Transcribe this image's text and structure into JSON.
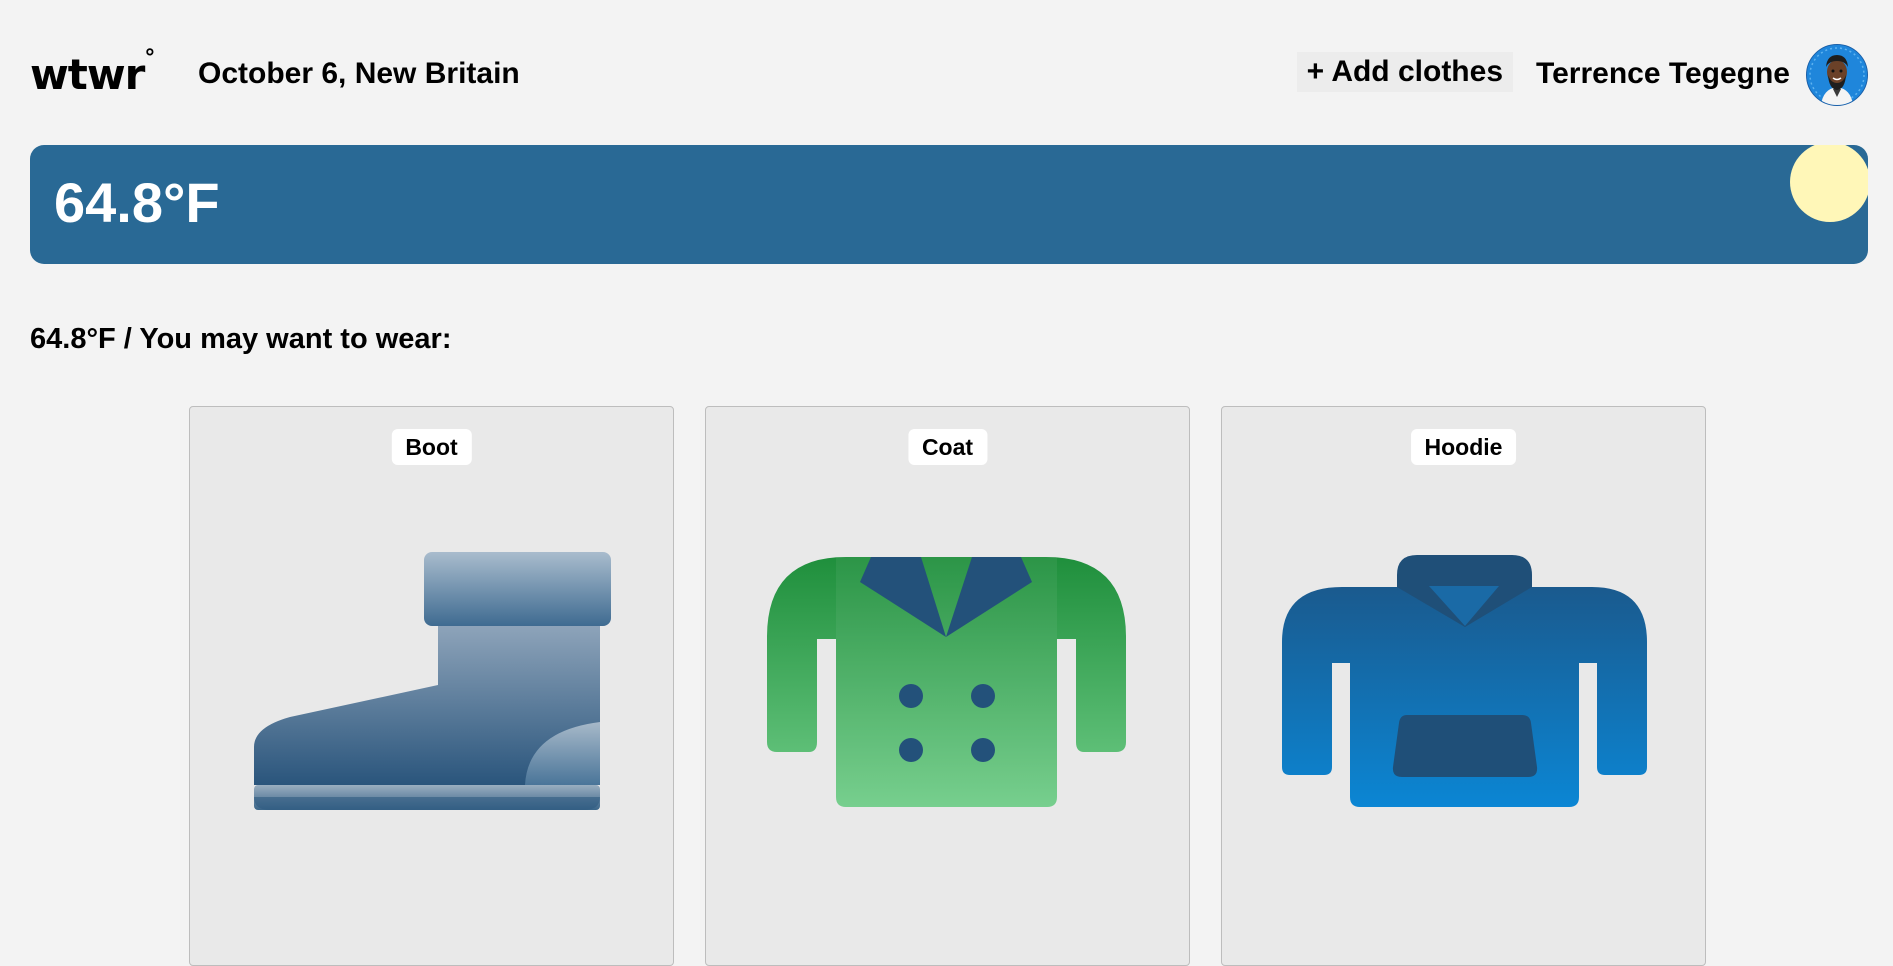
{
  "header": {
    "logo": "wtwr",
    "logo_degree": "°",
    "date_location": "October 6, New Britain",
    "add_clothes_label": "+ Add clothes",
    "user_name": "Terrence Tegegne"
  },
  "weather": {
    "temperature": "64.8°F",
    "condition_icon": "sun-icon",
    "card_color": "#296995"
  },
  "recommendation": {
    "text": "64.8°F / You may want to wear:"
  },
  "items": [
    {
      "name": "Boot",
      "icon": "boot-icon"
    },
    {
      "name": "Coat",
      "icon": "coat-icon"
    },
    {
      "name": "Hoodie",
      "icon": "hoodie-icon"
    }
  ]
}
